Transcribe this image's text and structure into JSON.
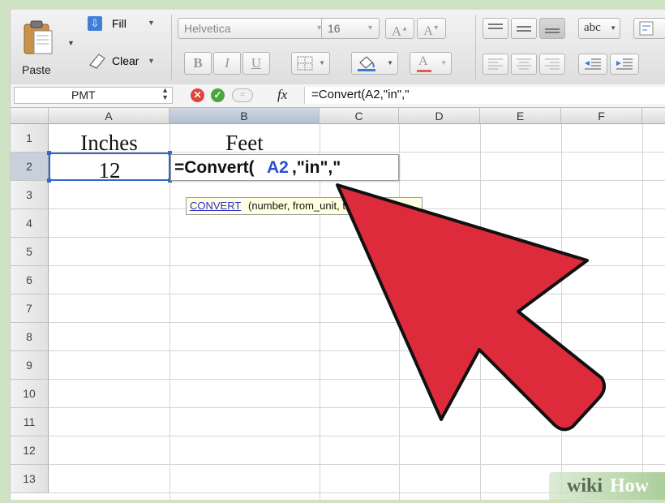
{
  "ribbon": {
    "paste_label": "Paste",
    "fill_label": "Fill",
    "clear_label": "Clear",
    "font_name": "Helvetica",
    "font_size": "16",
    "spelling_label": "abc"
  },
  "formula_bar": {
    "name_box": "PMT",
    "fx_label": "fx",
    "formula": "=Convert(A2,\"in\",\""
  },
  "columns": [
    "A",
    "B",
    "C",
    "D",
    "E",
    "F"
  ],
  "rows": [
    "1",
    "2",
    "3",
    "4",
    "5",
    "6",
    "7",
    "8",
    "9",
    "10",
    "11",
    "12",
    "13"
  ],
  "cells": {
    "a1": "Inches",
    "b1": "Feet",
    "a2": "12"
  },
  "editor": {
    "prefix": "=Convert(",
    "ref": "A2",
    "suffix": ",\"in\",\""
  },
  "tooltip": {
    "func": "CONVERT",
    "args": "(number, from_unit, to_unit)"
  },
  "watermark": {
    "part1": "wiki",
    "part2": "How"
  },
  "colors": {
    "arrow": "#dd2b3c",
    "selection": "#3366cc",
    "ref_blue": "#2a4fd0",
    "cancel_red": "#e0443a",
    "accept_green": "#46a83c"
  }
}
